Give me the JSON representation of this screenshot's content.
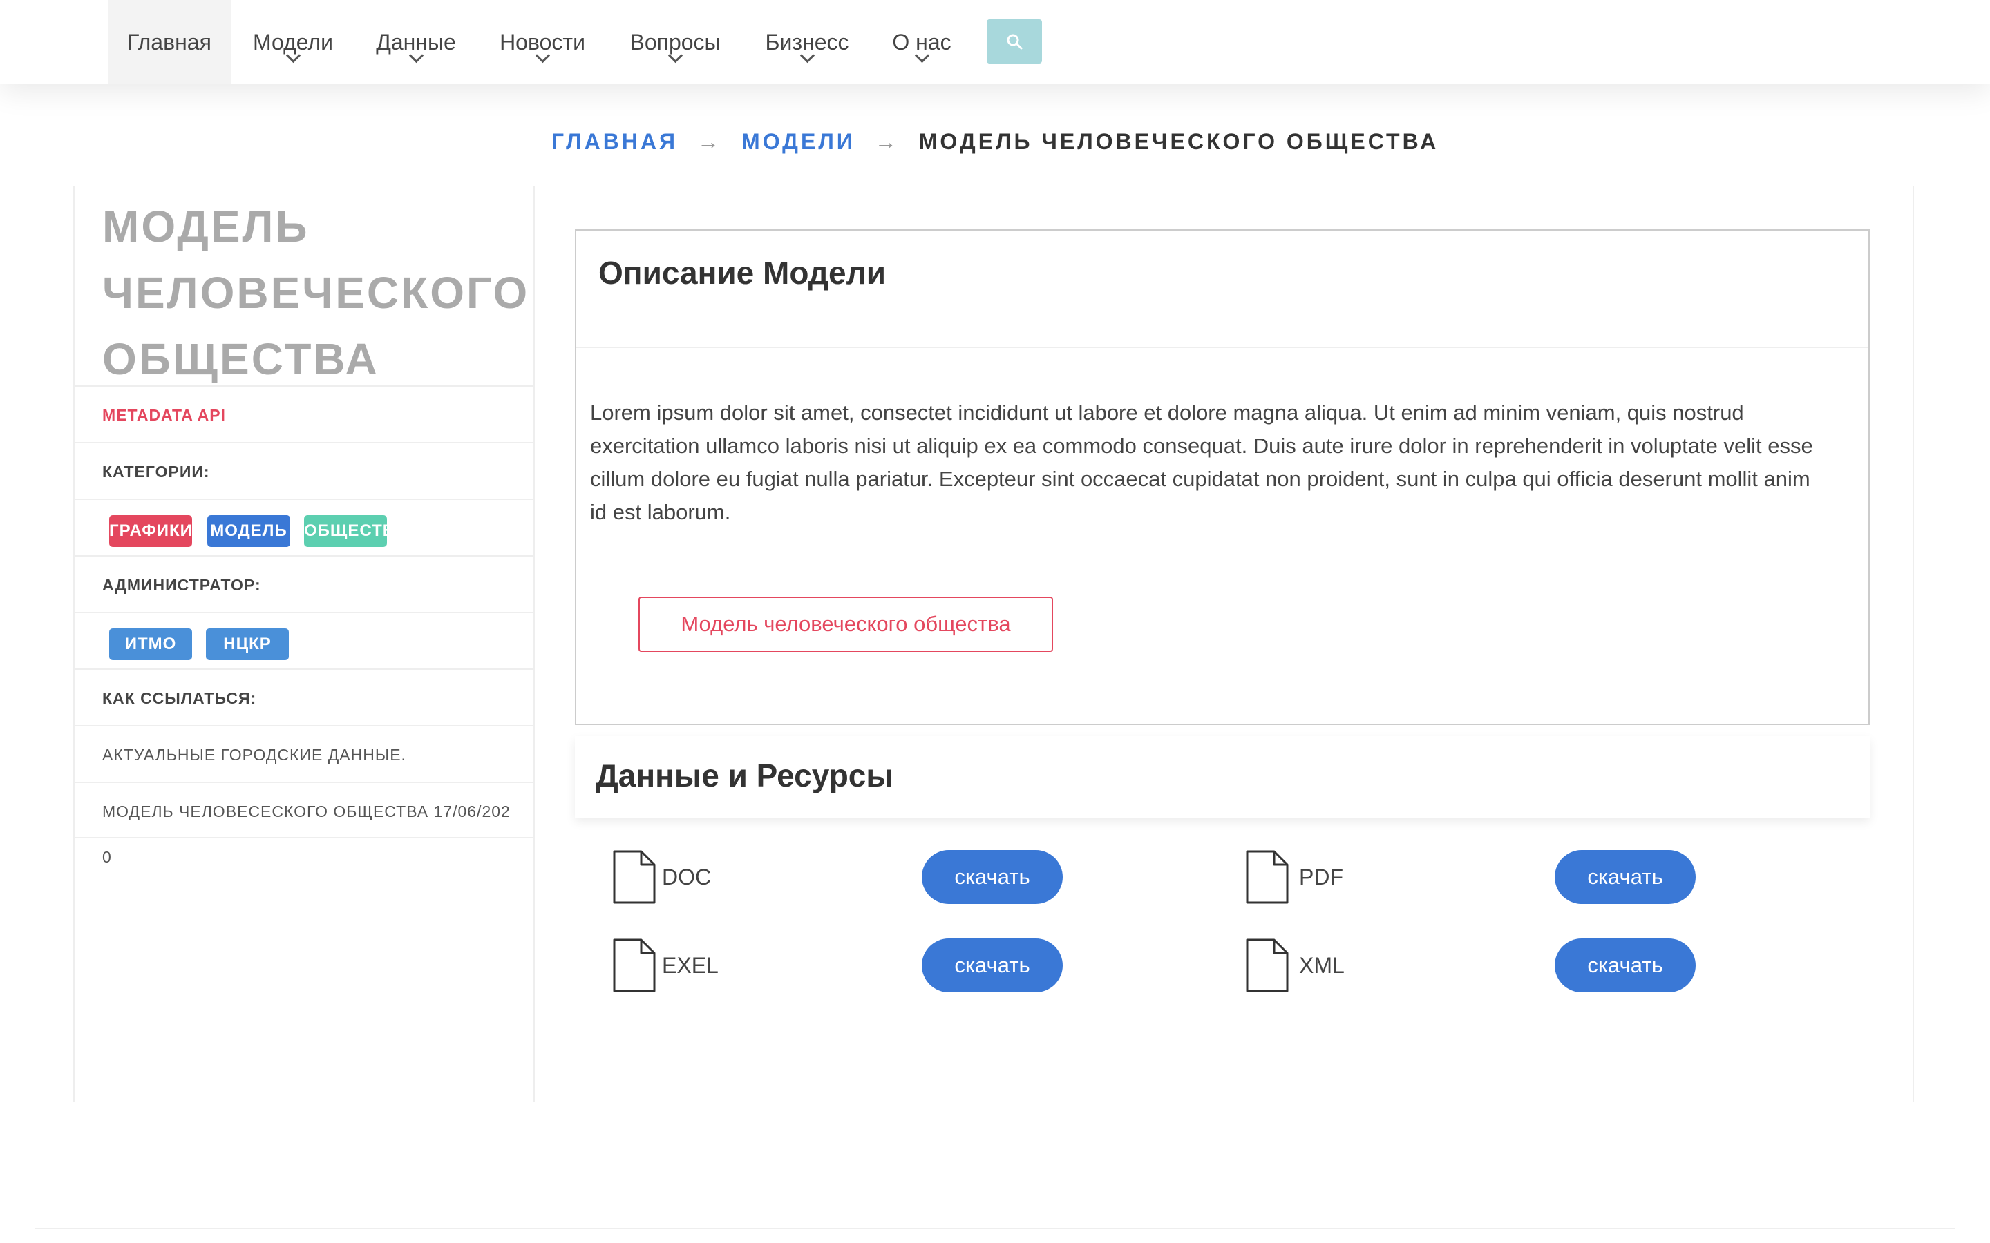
{
  "nav": {
    "items": [
      {
        "label": "Главная",
        "active": true,
        "dropdown": false
      },
      {
        "label": "Модели",
        "active": false,
        "dropdown": true
      },
      {
        "label": "Данные",
        "active": false,
        "dropdown": true
      },
      {
        "label": "Новости",
        "active": false,
        "dropdown": true
      },
      {
        "label": "Вопросы",
        "active": false,
        "dropdown": true
      },
      {
        "label": "Бизнесс",
        "active": false,
        "dropdown": true
      },
      {
        "label": "О нас",
        "active": false,
        "dropdown": true
      }
    ],
    "search_icon": "search-icon"
  },
  "breadcrumb": {
    "home": "ГЛАВНАЯ",
    "section": "МОДЕЛИ",
    "current": "МОДЕЛЬ ЧЕЛОВЕЧЕСКОГО ОБЩЕСТВА",
    "separator": "→"
  },
  "sidebar": {
    "title_lines": [
      "МОДЕЛЬ",
      "ЧЕЛОВЕЧЕСКОГО",
      "ОБЩЕСТВА"
    ],
    "metadata_api": "METADATA API",
    "categories_label": "КАТЕГОРИИ:",
    "categories": [
      {
        "label": "ГРАФИКИ",
        "color": "#e4475e"
      },
      {
        "label": "МОДЕЛЬ",
        "color": "#3a78d6"
      },
      {
        "label": "ОБЩЕСТВО",
        "color": "#5ccfb0"
      }
    ],
    "admin_label": "АДМИНИСТРАТОР:",
    "admins": [
      {
        "label": "ИТМО",
        "color": "#4a90d9"
      },
      {
        "label": "НЦКР",
        "color": "#4a90d9"
      }
    ],
    "cite_label": "КАК ССЫЛАТЬСЯ:",
    "cite_lines": [
      "АКТУАЛЬНЫЕ ГОРОДСКИЕ ДАННЫЕ.",
      "МОДЕЛЬ ЧЕЛОВЕСЕСКОГО ОБЩЕСТВА 17/06/202"
    ],
    "cite_tail": "0"
  },
  "description": {
    "title": "Описание Модели",
    "text": "Lorem ipsum dolor sit amet, consectet incididunt ut labore et dolore magna aliqua. Ut enim ad minim veniam, quis nostrud exercitation ullamco laboris nisi ut aliquip ex ea commodo consequat. Duis aute irure dolor in reprehenderit in voluptate velit esse cillum dolore eu fugiat nulla pariatur. Excepteur sint occaecat cupidatat non proident, sunt in culpa qui officia deserunt mollit anim id est laborum.",
    "model_button": "Модель человеческого общества"
  },
  "resources": {
    "title": "Данные и Ресурсы",
    "files": [
      {
        "label": "DOC",
        "icon": "file-icon",
        "button": "скачать"
      },
      {
        "label": "PDF",
        "icon": "file-icon",
        "button": "скачать"
      },
      {
        "label": "EXEL",
        "icon": "file-icon",
        "button": "скачать"
      },
      {
        "label": "XML",
        "icon": "file-icon",
        "button": "скачать"
      }
    ]
  },
  "colors": {
    "accent_blue": "#3a78d6",
    "accent_red": "#e4475e",
    "search_bg": "#a8d8dc"
  }
}
